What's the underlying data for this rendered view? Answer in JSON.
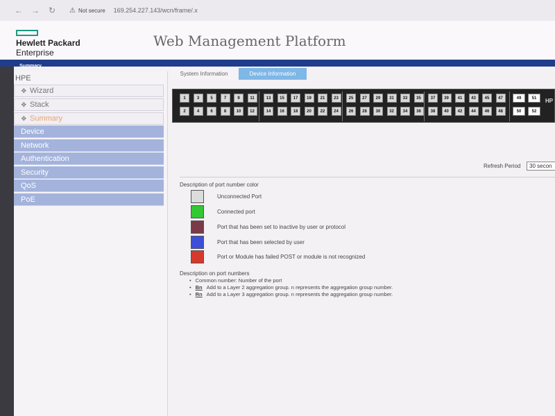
{
  "browser": {
    "back_icon": "arrow-left-icon",
    "security_text": "Not secure",
    "url": "169.254.227.143/wcn/frame/.x"
  },
  "header": {
    "logo_line1": "Hewlett Packard",
    "logo_line2": "Enterprise",
    "title": "Web Management Platform",
    "breadcrumb": "Summary"
  },
  "sidebar": {
    "title": "HPE",
    "items": [
      {
        "label": "Wizard",
        "style": "light"
      },
      {
        "label": "Stack",
        "style": "light"
      },
      {
        "label": "Summary",
        "style": "light-active"
      },
      {
        "label": "Device",
        "style": "blue"
      },
      {
        "label": "Network",
        "style": "blue"
      },
      {
        "label": "Authentication",
        "style": "blue"
      },
      {
        "label": "Security",
        "style": "blue"
      },
      {
        "label": "QoS",
        "style": "blue"
      },
      {
        "label": "PoE",
        "style": "blue"
      }
    ]
  },
  "tabs": {
    "system": "System Information",
    "device": "Device Information"
  },
  "switch": {
    "top_ports": [
      "1",
      "3",
      "5",
      "7",
      "9",
      "11",
      "13",
      "15",
      "17",
      "19",
      "21",
      "23",
      "25",
      "27",
      "29",
      "31",
      "33",
      "35",
      "37",
      "39",
      "41",
      "43",
      "45",
      "47"
    ],
    "bottom_ports": [
      "2",
      "4",
      "6",
      "8",
      "10",
      "12",
      "14",
      "16",
      "18",
      "20",
      "22",
      "24",
      "26",
      "28",
      "30",
      "32",
      "34",
      "36",
      "38",
      "40",
      "42",
      "44",
      "46",
      "48"
    ],
    "sfp_top": [
      "49",
      "51"
    ],
    "sfp_bottom": [
      "50",
      "52"
    ],
    "brand": "HP"
  },
  "refresh": {
    "label": "Refresh Period",
    "value": "30 secon"
  },
  "color_legend": {
    "title": "Description of port number color",
    "items": [
      {
        "label": "Unconnected Port",
        "color": "#dcdcdc"
      },
      {
        "label": "Connected port",
        "color": "#33c733"
      },
      {
        "label": "Port that has been set to inactive by user or protocol",
        "color": "#7a3a48"
      },
      {
        "label": "Port that has been selected by user",
        "color": "#3d4fd6"
      },
      {
        "label": "Port or Module has failed POST or module is not recognized",
        "color": "#d6392c"
      }
    ]
  },
  "port_numbers": {
    "title": "Description on port numbers",
    "items": [
      {
        "code": "",
        "text": "Common number: Number of the port"
      },
      {
        "code": "Bn",
        "text": "Add to a Layer 2 aggregation group. n represents the aggregation group number."
      },
      {
        "code": "Rn",
        "text": "Add to a Layer 3 aggregation group. n represents the aggregation group number."
      }
    ]
  }
}
